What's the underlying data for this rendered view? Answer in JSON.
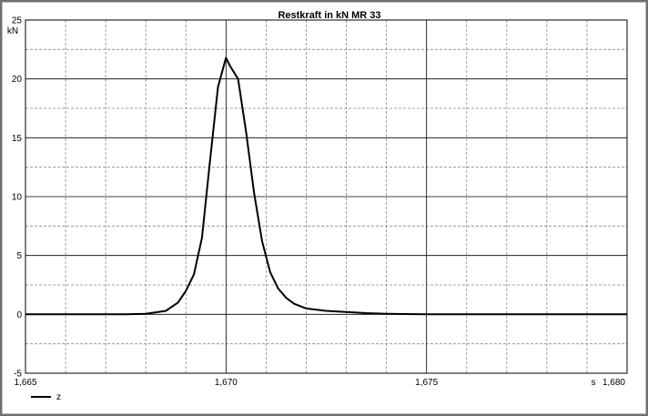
{
  "chart_data": {
    "type": "line",
    "title": "Restkraft in kN MR 33",
    "ylabel": "kN",
    "xlabel": "s",
    "xlim": [
      1.665,
      1.68
    ],
    "ylim": [
      -5,
      25
    ],
    "grid": true,
    "legend_position": "bottom-left",
    "x_ticks": [
      1.665,
      1.67,
      1.675,
      1.68
    ],
    "x_tick_labels": [
      "1,665",
      "1,670",
      "1,675",
      "1,680"
    ],
    "y_ticks": [
      -5,
      0,
      5,
      10,
      15,
      20,
      25
    ],
    "y_tick_labels": [
      "-5",
      "0",
      "5",
      "10",
      "15",
      "20",
      "25"
    ],
    "line_color": "#000000",
    "series": [
      {
        "name": "z",
        "x": [
          1.665,
          1.666,
          1.667,
          1.6675,
          1.668,
          1.6685,
          1.6688,
          1.669,
          1.6692,
          1.6694,
          1.6696,
          1.6698,
          1.67,
          1.6701,
          1.6703,
          1.6705,
          1.6707,
          1.6709,
          1.6711,
          1.6713,
          1.6715,
          1.6717,
          1.672,
          1.6725,
          1.673,
          1.6735,
          1.674,
          1.675,
          1.676,
          1.677,
          1.678,
          1.679,
          1.68
        ],
        "y": [
          0,
          0,
          0,
          0,
          0.05,
          0.3,
          1,
          2,
          3.4,
          6.5,
          13,
          19.3,
          21.8,
          21.1,
          20,
          15.5,
          10.3,
          6.2,
          3.6,
          2.2,
          1.4,
          0.9,
          0.5,
          0.3,
          0.2,
          0.1,
          0.05,
          0,
          0,
          0,
          0,
          0,
          0
        ]
      }
    ]
  }
}
